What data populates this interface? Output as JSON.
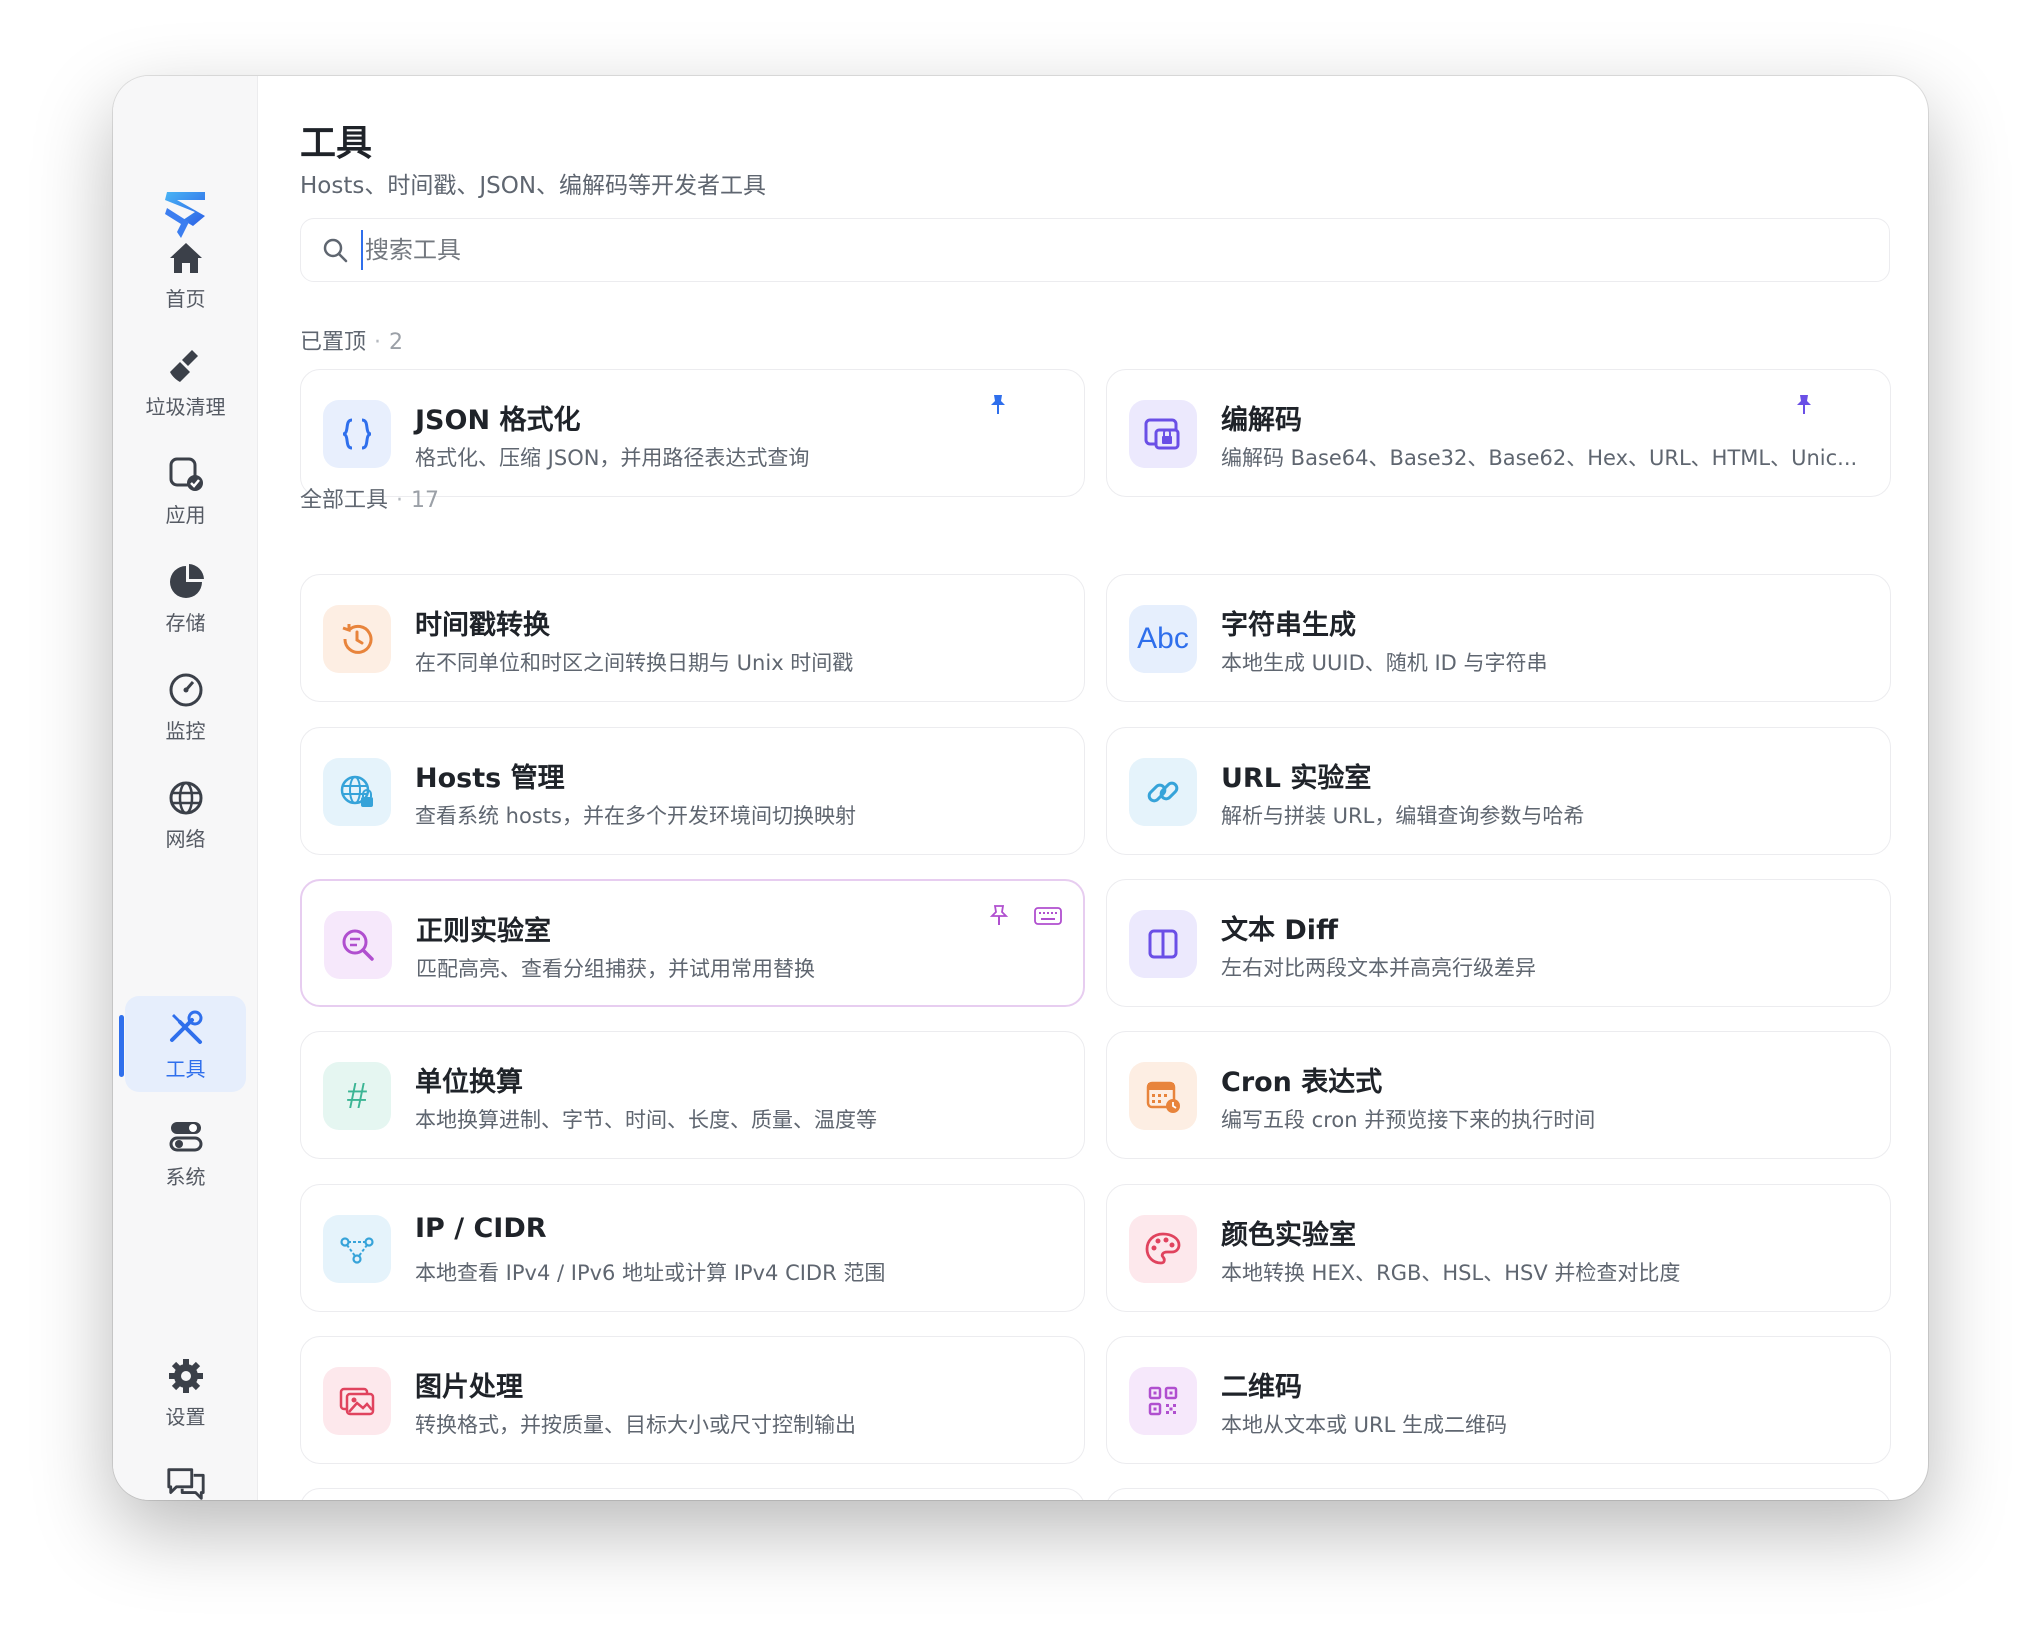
{
  "sidebar": {
    "items": [
      {
        "label": "首页"
      },
      {
        "label": "垃圾清理"
      },
      {
        "label": "应用"
      },
      {
        "label": "存储"
      },
      {
        "label": "监控"
      },
      {
        "label": "网络"
      },
      {
        "label": "工具"
      },
      {
        "label": "系统"
      },
      {
        "label": "设置"
      },
      {
        "label": "反馈"
      }
    ],
    "active": "工具"
  },
  "header": {
    "title": "工具",
    "subtitle": "Hosts、时间戳、JSON、编解码等开发者工具"
  },
  "search": {
    "placeholder": "搜索工具",
    "value": ""
  },
  "pinned": {
    "label": "已置顶",
    "count": "2",
    "cards": [
      {
        "title": "JSON 格式化",
        "desc": "格式化、压缩 JSON，并用路径表达式查询",
        "icon": "braces-icon"
      },
      {
        "title": "编解码",
        "desc": "编解码 Base64、Base32、Base62、Hex、URL、HTML、Unic...",
        "icon": "lock-window-icon"
      }
    ]
  },
  "all": {
    "label": "全部工具",
    "count": "17",
    "cards": [
      {
        "title": "时间戳转换",
        "desc": "在不同单位和时区之间转换日期与 Unix 时间戳",
        "icon": "clock-history-icon"
      },
      {
        "title": "字符串生成",
        "desc": "本地生成 UUID、随机 ID 与字符串",
        "icon": "abc-icon",
        "icon_text": "Abc"
      },
      {
        "title": "Hosts 管理",
        "desc": "查看系统 hosts，并在多个开发环境间切换映射",
        "icon": "globe-lock-icon"
      },
      {
        "title": "URL 实验室",
        "desc": "解析与拼装 URL，编辑查询参数与哈希",
        "icon": "link-icon"
      },
      {
        "title": "正则实验室",
        "desc": "匹配高亮、查看分组捕获，并试用常用替换",
        "icon": "search-regex-icon"
      },
      {
        "title": "文本 Diff",
        "desc": "左右对比两段文本并高亮行级差异",
        "icon": "split-view-icon"
      },
      {
        "title": "单位换算",
        "desc": "本地换算进制、字节、时间、长度、质量、温度等",
        "icon": "hash-icon",
        "icon_text": "#"
      },
      {
        "title": "Cron 表达式",
        "desc": "编写五段 cron 并预览接下来的执行时间",
        "icon": "calendar-clock-icon"
      },
      {
        "title": "IP / CIDR",
        "desc": "本地查看 IPv4 / IPv6 地址或计算 IPv4 CIDR 范围",
        "icon": "network-nodes-icon"
      },
      {
        "title": "颜色实验室",
        "desc": "本地转换 HEX、RGB、HSL、HSV 并检查对比度",
        "icon": "palette-icon"
      },
      {
        "title": "图片处理",
        "desc": "转换格式，并按质量、目标大小或尺寸控制输出",
        "icon": "images-icon"
      },
      {
        "title": "二维码",
        "desc": "本地从文本或 URL 生成二维码",
        "icon": "qr-code-icon"
      }
    ]
  },
  "colors": {
    "accent": "#2f6fec",
    "pin": "#2f6fec",
    "regex_pin": "#b04fcf"
  }
}
